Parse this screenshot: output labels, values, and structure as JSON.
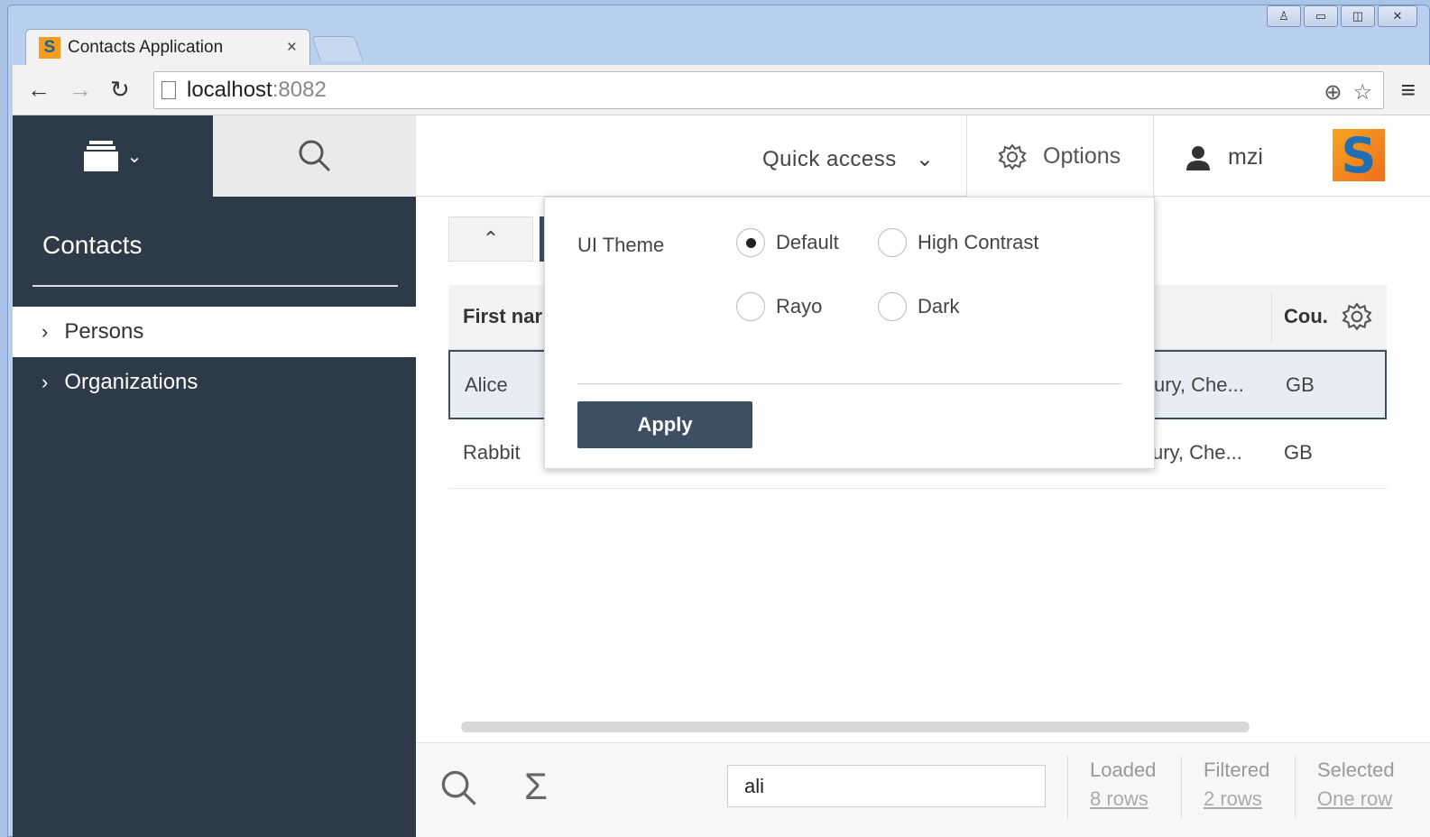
{
  "browser": {
    "tab_title": "Contacts Application",
    "tab_close": "×",
    "url_host": "localhost",
    "url_port": ":8082"
  },
  "sidebar": {
    "title": "Contacts",
    "items": [
      {
        "label": "Persons",
        "active": true
      },
      {
        "label": "Organizations",
        "active": false
      }
    ]
  },
  "header": {
    "quick_access": "Quick access",
    "options": "Options",
    "user": "mzi"
  },
  "table": {
    "columns": [
      "First nar",
      "Cou."
    ],
    "rows": [
      {
        "first": "Alice",
        "address": "ury, Che...",
        "country": "GB",
        "selected": true
      },
      {
        "first": "Rabbit",
        "address": "ury, Che...",
        "country": "GB",
        "selected": false
      }
    ]
  },
  "footer": {
    "search_value": "ali",
    "loaded_label": "Loaded",
    "loaded_value": "8 rows",
    "filtered_label": "Filtered",
    "filtered_value": "2 rows",
    "selected_label": "Selected",
    "selected_value": "One row"
  },
  "options_popup": {
    "label": "UI Theme",
    "themes": [
      "Default",
      "High Contrast",
      "Rayo",
      "Dark"
    ],
    "selected_theme": "Default",
    "apply_label": "Apply"
  },
  "colors": {
    "sidebar_bg": "#2d3a48",
    "accent": "#3e4f63"
  }
}
